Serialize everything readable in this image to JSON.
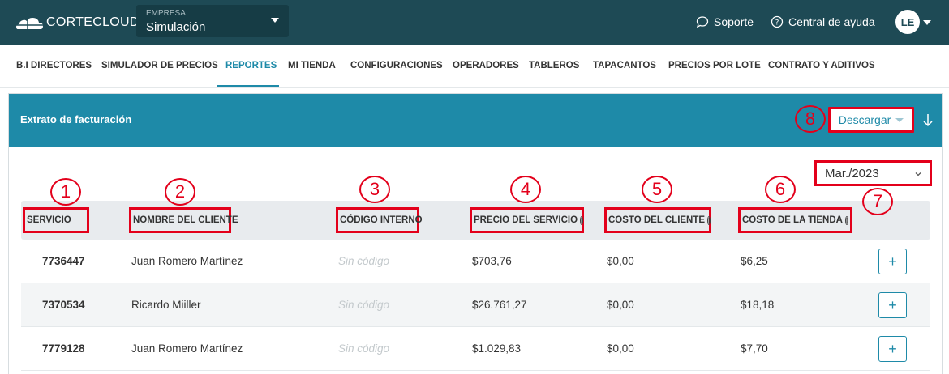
{
  "header": {
    "logo_text": "CORTECLOUD",
    "empresa_label": "EMPRESA",
    "empresa_value": "Simulación",
    "soporte": "Soporte",
    "ayuda": "Central de ayuda",
    "avatar": "LE"
  },
  "nav": {
    "items": [
      {
        "label": "B.I DIRECTORES"
      },
      {
        "label": "SIMULADOR DE PRECIOS"
      },
      {
        "label": "REPORTES"
      },
      {
        "label": "MI TIENDA"
      },
      {
        "label": "CONFIGURACIONES"
      },
      {
        "label": "OPERADORES"
      },
      {
        "label": "TABLEROS"
      },
      {
        "label": "TAPACANTOS"
      },
      {
        "label": "PRECIOS POR LOTE"
      },
      {
        "label": "CONTRATO Y ADITIVOS"
      }
    ],
    "active": "REPORTES"
  },
  "card": {
    "title": "Extrato de facturación",
    "download_label": "Descargar",
    "month": "Mar./2023"
  },
  "table": {
    "columns": [
      "SERVICIO",
      "NOMBRE DEL CLIENTE",
      "CÓDIGO INTERNO",
      "PRECIO DEL SERVICIO",
      "COSTO DEL CLIENTE",
      "COSTO DE LA TIENDA"
    ],
    "rows": [
      {
        "servicio": "7736447",
        "cliente": "Juan Romero Martínez",
        "codigo": "Sin código",
        "precio": "$703,76",
        "costo_cliente": "$0,00",
        "costo_tienda": "$6,25",
        "action": "+"
      },
      {
        "servicio": "7370534",
        "cliente": "Ricardo Miiller",
        "codigo": "Sin código",
        "precio": "$26.761,27",
        "costo_cliente": "$0,00",
        "costo_tienda": "$18,18",
        "action": "+"
      },
      {
        "servicio": "7779128",
        "cliente": "Juan Romero Martínez",
        "codigo": "Sin código",
        "precio": "$1.029,83",
        "costo_cliente": "$0,00",
        "costo_tienda": "$7,70",
        "action": "+"
      }
    ]
  },
  "annotations": [
    "1",
    "2",
    "3",
    "4",
    "5",
    "6",
    "7",
    "8"
  ],
  "colors": {
    "topbar": "#1e4a55",
    "accent": "#1e8aa8",
    "highlight": "#e3001b"
  }
}
